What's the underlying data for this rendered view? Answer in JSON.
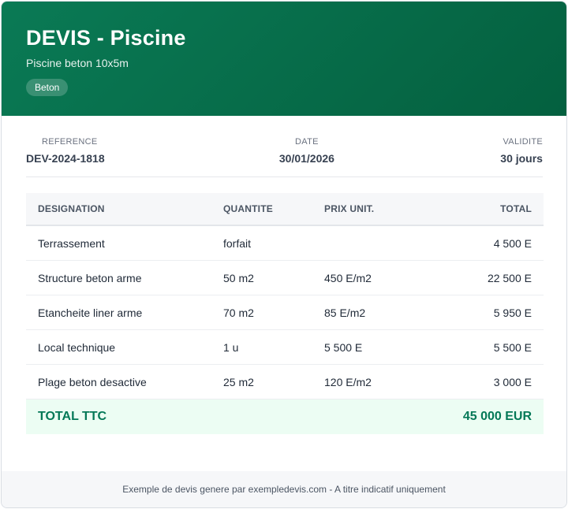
{
  "header": {
    "title": "DEVIS - Piscine",
    "subtitle": "Piscine beton 10x5m",
    "badge": "Beton"
  },
  "meta": {
    "reference_label": "REFERENCE",
    "reference_value": "DEV-2024-1818",
    "date_label": "DATE",
    "date_value": "30/01/2026",
    "validity_label": "VALIDITE",
    "validity_value": "30 jours"
  },
  "table": {
    "headers": [
      "DESIGNATION",
      "QUANTITE",
      "PRIX UNIT.",
      "TOTAL"
    ],
    "rows": [
      [
        "Terrassement",
        "forfait",
        "",
        "4 500 E"
      ],
      [
        "Structure beton arme",
        "50 m2",
        "450 E/m2",
        "22 500 E"
      ],
      [
        "Etancheite liner arme",
        "70 m2",
        "85 E/m2",
        "5 950 E"
      ],
      [
        "Local technique",
        "1 u",
        "5 500 E",
        "5 500 E"
      ],
      [
        "Plage beton desactive",
        "25 m2",
        "120 E/m2",
        "3 000 E"
      ]
    ],
    "total_label": "TOTAL TTC",
    "total_value": "45 000 EUR"
  },
  "footer": {
    "text": "Exemple de devis genere par exempledevis.com - A titre indicatif uniquement"
  }
}
